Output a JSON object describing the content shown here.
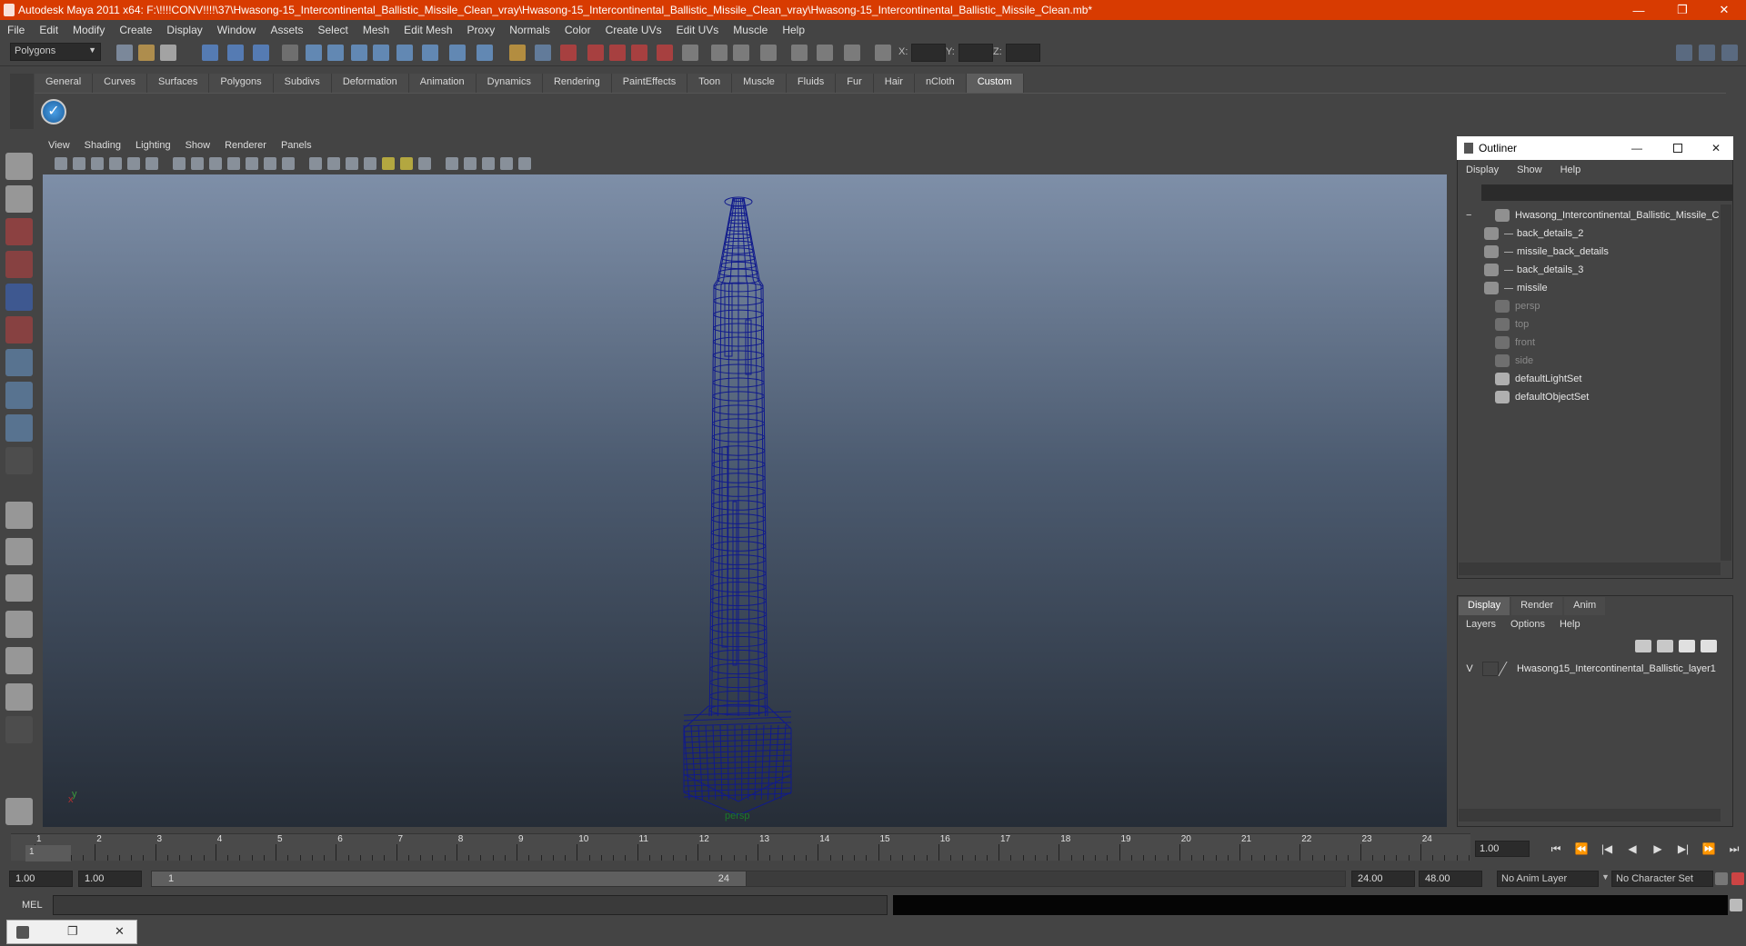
{
  "window": {
    "title": "Autodesk Maya 2011 x64: F:\\!!!!CONV!!!!\\37\\Hwasong-15_Intercontinental_Ballistic_Missile_Clean_vray\\Hwasong-15_Intercontinental_Ballistic_Missile_Clean_vray\\Hwasong-15_Intercontinental_Ballistic_Missile_Clean.mb*",
    "minimize": "—",
    "restore": "❐",
    "close": "✕"
  },
  "menubar": [
    "File",
    "Edit",
    "Modify",
    "Create",
    "Display",
    "Window",
    "Assets",
    "Select",
    "Mesh",
    "Edit Mesh",
    "Proxy",
    "Normals",
    "Color",
    "Create UVs",
    "Edit UVs",
    "Muscle",
    "Help"
  ],
  "statusline": {
    "mode": "Polygons",
    "x_label": "X:",
    "y_label": "Y:",
    "z_label": "Z:"
  },
  "shelf": {
    "tabs": [
      "General",
      "Curves",
      "Surfaces",
      "Polygons",
      "Subdivs",
      "Deformation",
      "Animation",
      "Dynamics",
      "Rendering",
      "PaintEffects",
      "Toon",
      "Muscle",
      "Fluids",
      "Fur",
      "Hair",
      "nCloth",
      "Custom"
    ],
    "active_tab": "Custom"
  },
  "viewport": {
    "menu": [
      "View",
      "Shading",
      "Lighting",
      "Show",
      "Renderer",
      "Panels"
    ],
    "camera_label": "persp",
    "axis_y": "y",
    "axis_x": "x"
  },
  "outliner": {
    "title": "Outliner",
    "menu": [
      "Display",
      "Show",
      "Help"
    ],
    "items": [
      {
        "label": "Hwasong_Intercontinental_Ballistic_Missile_C",
        "dim": false,
        "indent": 0,
        "collapse": "−"
      },
      {
        "label": "back_details_2",
        "dim": false,
        "indent": 1
      },
      {
        "label": "missile_back_details",
        "dim": false,
        "indent": 1
      },
      {
        "label": "back_details_3",
        "dim": false,
        "indent": 1
      },
      {
        "label": "missile",
        "dim": false,
        "indent": 1
      },
      {
        "label": "persp",
        "dim": true,
        "indent": 0
      },
      {
        "label": "top",
        "dim": true,
        "indent": 0
      },
      {
        "label": "front",
        "dim": true,
        "indent": 0
      },
      {
        "label": "side",
        "dim": true,
        "indent": 0
      },
      {
        "label": "defaultLightSet",
        "dim": false,
        "indent": 0
      },
      {
        "label": "defaultObjectSet",
        "dim": false,
        "indent": 0
      }
    ]
  },
  "layers": {
    "tabs": [
      "Display",
      "Render",
      "Anim"
    ],
    "active_tab": "Display",
    "menu": [
      "Layers",
      "Options",
      "Help"
    ],
    "row": {
      "visible": "V",
      "name": "Hwasong15_Intercontinental_Ballistic_layer1"
    }
  },
  "timeline": {
    "ticks": [
      "1",
      "2",
      "3",
      "4",
      "5",
      "6",
      "7",
      "8",
      "9",
      "10",
      "11",
      "12",
      "13",
      "14",
      "15",
      "16",
      "17",
      "18",
      "19",
      "20",
      "21",
      "22",
      "23",
      "24"
    ],
    "current_frame_marker": "1",
    "current_time": "1.00"
  },
  "range": {
    "start_time": "1.00",
    "playback_start": "1.00",
    "slider_start": "1",
    "slider_end": "24",
    "playback_end": "24.00",
    "end_time": "48.00",
    "anim_layer": "No Anim Layer",
    "character_set": "No Character Set"
  },
  "mel": {
    "label": "MEL"
  },
  "playback": [
    "⏮",
    "⏪",
    "|◀",
    "◀",
    "▶",
    "▶|",
    "⏩",
    "⏭"
  ],
  "colors": {
    "titlebar": "#d83b01",
    "wireframe": "#101a8c",
    "viewport_top": "#7e8fa8",
    "viewport_bottom": "#262d37"
  }
}
